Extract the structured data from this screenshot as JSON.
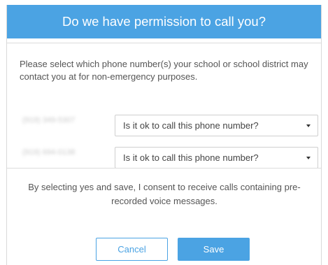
{
  "dialog": {
    "title": "Do we have permission to call you?",
    "intro": "Please select which phone number(s) your school or school district may contact you at for non-emergency purposes.",
    "phones": [
      {
        "number": "(919) 349-5307",
        "select_value": "Is it ok to call this phone number?"
      },
      {
        "number": "(919) 694-0138",
        "select_value": "Is it ok to call this phone number?"
      }
    ],
    "consent": "By selecting yes and save, I consent to receive calls containing pre-recorded voice messages.",
    "cancel_label": "Cancel",
    "save_label": "Save"
  },
  "colors": {
    "accent": "#4ba3e3",
    "text": "#555555",
    "border": "#cfcfcf"
  },
  "icons": {
    "select_caret": "chevron-down-icon"
  }
}
